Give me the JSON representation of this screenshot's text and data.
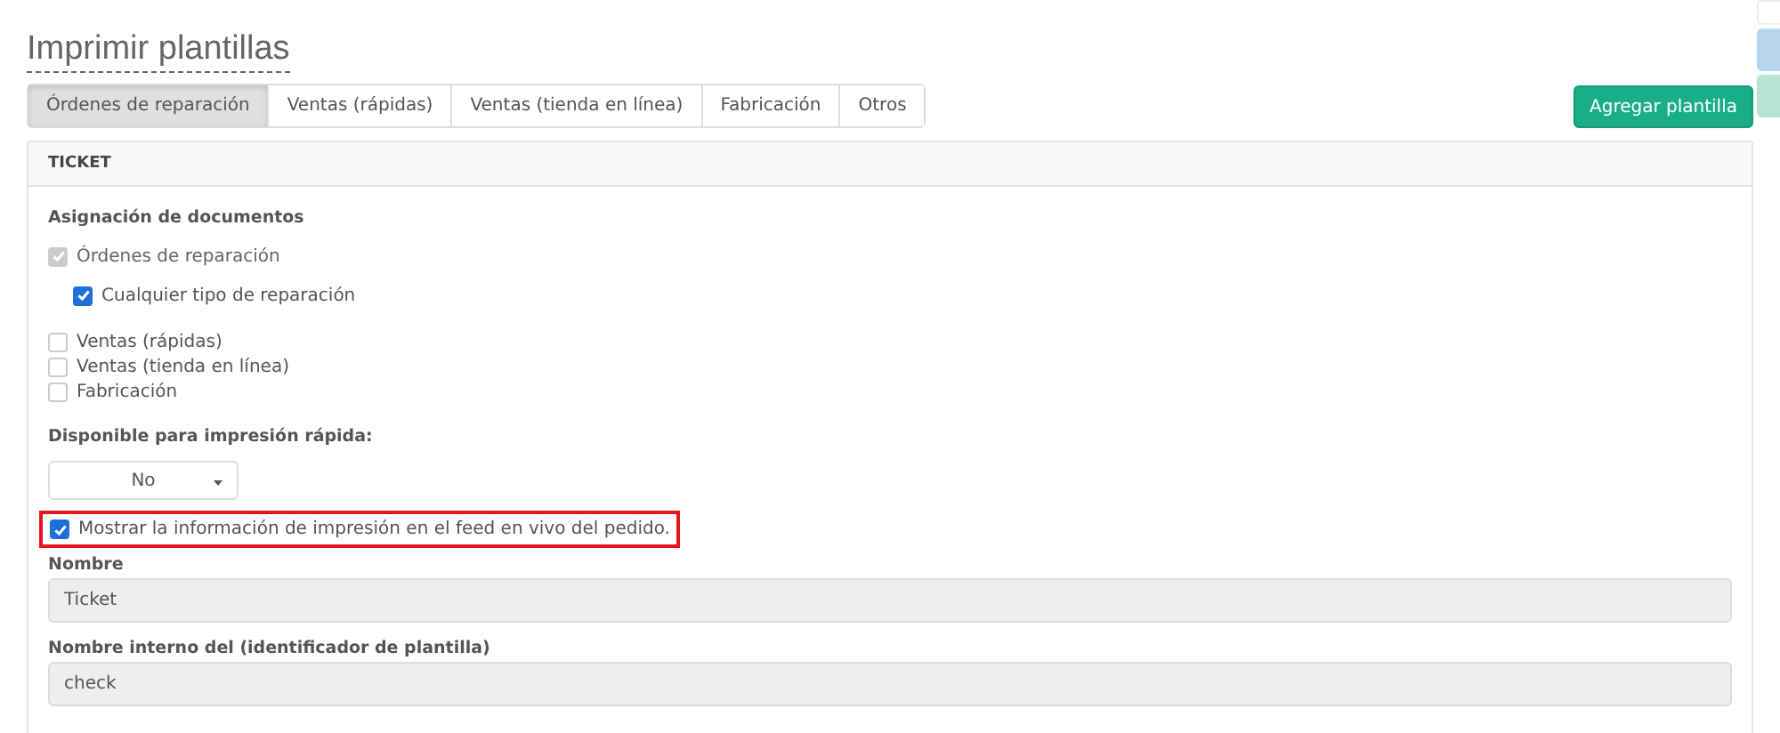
{
  "page": {
    "title": "Imprimir plantillas"
  },
  "tabs": [
    {
      "label": "Órdenes de reparación",
      "selected": true
    },
    {
      "label": "Ventas (rápidas)",
      "selected": false
    },
    {
      "label": "Ventas (tienda en línea)",
      "selected": false
    },
    {
      "label": "Fabricación",
      "selected": false
    },
    {
      "label": "Otros",
      "selected": false
    }
  ],
  "add_button": "Agregar plantilla",
  "panel": {
    "title": "TICKET",
    "assignment_label": "Asignación de documentos",
    "assignments": [
      {
        "label": "Órdenes de reparación",
        "checked": true,
        "disabled": true,
        "children": [
          {
            "label": "Cualquier tipo de reparación",
            "checked": true,
            "disabled": false
          }
        ]
      },
      {
        "label": "Ventas (rápidas)",
        "checked": false,
        "disabled": false
      },
      {
        "label": "Ventas (tienda en línea)",
        "checked": false,
        "disabled": false
      },
      {
        "label": "Fabricación",
        "checked": false,
        "disabled": false
      }
    ],
    "quick_print_label": "Disponible para impresión rápida:",
    "quick_print_value": "No",
    "live_feed": {
      "label": "Mostrar la información de impresión en el feed en vivo del pedido.",
      "checked": true,
      "highlighted": true
    },
    "fields": [
      {
        "label": "Nombre",
        "value": "Ticket"
      },
      {
        "label": "Nombre interno del (identificador de plantilla)",
        "value": "check"
      }
    ]
  }
}
